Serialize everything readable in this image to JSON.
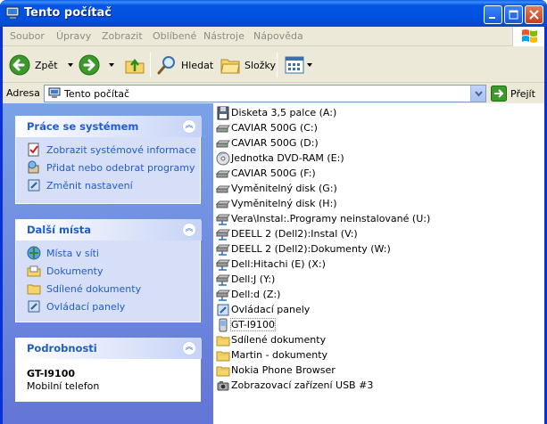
{
  "window": {
    "title": "Tento počítač"
  },
  "menubar": {
    "items": [
      "Soubor",
      "Úpravy",
      "Zobrazit",
      "Oblíbené",
      "Nástroje",
      "Nápověda"
    ]
  },
  "toolbar": {
    "back_label": "Zpět",
    "search_label": "Hledat",
    "folders_label": "Složky"
  },
  "address": {
    "label": "Adresa",
    "value": "Tento počítač",
    "go_label": "Přejít"
  },
  "tasks": {
    "system": {
      "title": "Práce se systémem",
      "items": [
        {
          "label": "Zobrazit systémové informace",
          "icon": "system-info-icon"
        },
        {
          "label": "Přidat nebo odebrat programy",
          "icon": "add-remove-programs-icon"
        },
        {
          "label": "Změnit nastavení",
          "icon": "control-settings-icon"
        }
      ]
    },
    "places": {
      "title": "Další místa",
      "items": [
        {
          "label": "Místa v síti",
          "icon": "network-places-icon"
        },
        {
          "label": "Dokumenty",
          "icon": "documents-icon"
        },
        {
          "label": "Sdílené dokumenty",
          "icon": "shared-folder-icon"
        },
        {
          "label": "Ovládací panely",
          "icon": "control-panel-icon"
        }
      ]
    },
    "details": {
      "title": "Podrobnosti",
      "name": "GT-I9100",
      "type": "Mobilní telefon"
    }
  },
  "items": [
    {
      "label": "Disketa 3,5 palce (A:)",
      "icon": "floppy-icon"
    },
    {
      "label": "CAVIAR 500G (C:)",
      "icon": "hard-drive-icon"
    },
    {
      "label": "CAVIAR 500G (D:)",
      "icon": "hard-drive-icon"
    },
    {
      "label": "Jednotka DVD-RAM (E:)",
      "icon": "dvd-drive-icon"
    },
    {
      "label": "CAVIAR 500G (F:)",
      "icon": "hard-drive-icon"
    },
    {
      "label": "Vyměnitelný disk (G:)",
      "icon": "removable-disk-icon"
    },
    {
      "label": "Vyměnitelný disk (H:)",
      "icon": "removable-disk-icon"
    },
    {
      "label": "Vera\\Instal:.Programy neinstalované (U:)",
      "icon": "network-drive-icon"
    },
    {
      "label": "DEELL 2 (Dell2):Instal (V:)",
      "icon": "network-drive-icon"
    },
    {
      "label": "DEELL 2 (Dell2):Dokumenty (W:)",
      "icon": "network-drive-icon"
    },
    {
      "label": "Dell:Hitachi (E) (X:)",
      "icon": "network-drive-icon"
    },
    {
      "label": "Dell:J (Y:)",
      "icon": "network-drive-icon"
    },
    {
      "label": "Dell:d (Z:)",
      "icon": "network-drive-icon"
    },
    {
      "label": "Ovládací panely",
      "icon": "control-panel-icon"
    },
    {
      "label": "GT-I9100",
      "icon": "mobile-phone-icon",
      "selected": true
    },
    {
      "label": "Sdílené dokumenty",
      "icon": "folder-icon"
    },
    {
      "label": "Martin - dokumenty",
      "icon": "folder-icon"
    },
    {
      "label": "Nokia Phone Browser",
      "icon": "folder-icon"
    },
    {
      "label": "Zobrazovací zařízení USB #3",
      "icon": "usb-imaging-icon"
    }
  ]
}
